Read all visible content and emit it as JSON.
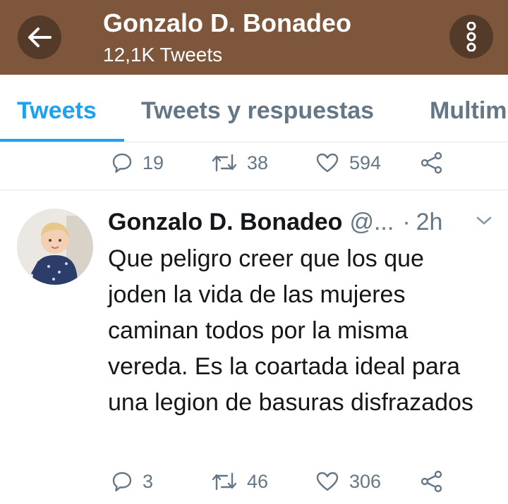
{
  "header": {
    "title": "Gonzalo D. Bonadeo",
    "subtitle": "12,1K Tweets",
    "back_icon": "arrow-left-icon",
    "menu_icon": "more-vertical-icon",
    "background_color": "#7d563c"
  },
  "tabs": [
    {
      "label": "Tweets",
      "active": true
    },
    {
      "label": "Tweets y respuestas",
      "active": false
    },
    {
      "label": "Multim",
      "active": false
    }
  ],
  "accent_color": "#1da1f2",
  "previous_tweet_actions": {
    "replies": "19",
    "retweets": "38",
    "likes": "594"
  },
  "tweet": {
    "author_name": "Gonzalo D. Bonadeo",
    "handle": "@...",
    "separator": "·",
    "time": "2h",
    "text": "Que peligro creer que los que joden la vida de las mujeres caminan todos por la misma vereda. Es la coartada ideal para una legion de basuras disfrazados",
    "replies": "3",
    "retweets": "46",
    "likes": "306"
  },
  "icons": {
    "reply": "reply-bubble-icon",
    "retweet": "retweet-icon",
    "like": "heart-icon",
    "share": "share-icon",
    "more": "chevron-down-icon"
  }
}
